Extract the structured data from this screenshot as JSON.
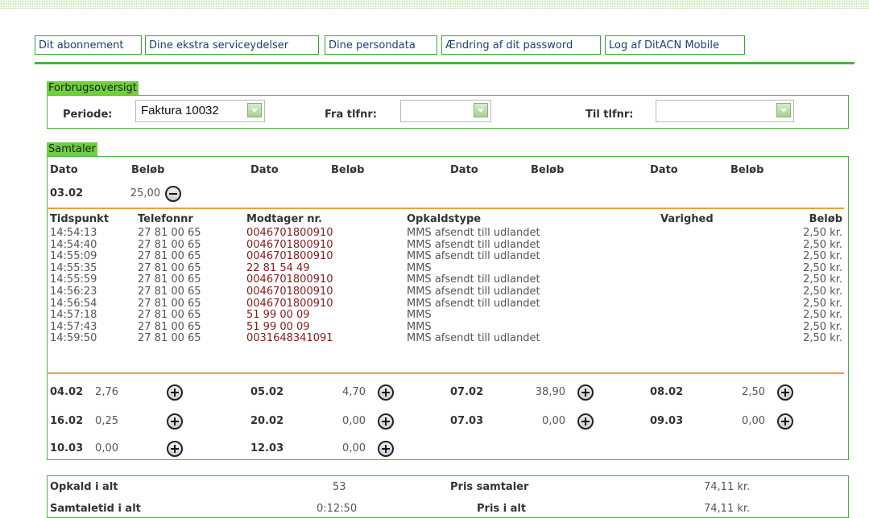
{
  "tabs": [
    "Dit abonnement",
    "Dine ekstra serviceydelser",
    "Dine persondata",
    "Ændring af dit password",
    "Log af DitACN Mobile"
  ],
  "usage": {
    "title": "Forbrugsoversigt",
    "periode_label": "Periode:",
    "periode_value": "Faktura 10032",
    "fra_label": "Fra tlfnr:",
    "fra_value": "",
    "til_label": "Til tlfnr:",
    "til_value": ""
  },
  "calls": {
    "title": "Samtaler",
    "col_headers": [
      "Dato",
      "Beløb",
      "Dato",
      "Beløb",
      "Dato",
      "Beløb",
      "Dato",
      "Beløb"
    ],
    "expanded_day": {
      "date": "03.02",
      "amount": "25,00"
    },
    "detail_headers": [
      "Tidspunkt",
      "Telefonnr",
      "Modtager nr.",
      "Opkaldstype",
      "Varighed",
      "Beløb"
    ],
    "detail_rows": [
      {
        "time": "14:54:13",
        "phone": "27 81 00 65",
        "receiver": "0046701800910",
        "type": "MMS afsendt till udlandet",
        "duration": "",
        "amount": "2,50 kr."
      },
      {
        "time": "14:54:40",
        "phone": "27 81 00 65",
        "receiver": "0046701800910",
        "type": "MMS afsendt till udlandet",
        "duration": "",
        "amount": "2,50 kr."
      },
      {
        "time": "14:55:09",
        "phone": "27 81 00 65",
        "receiver": "0046701800910",
        "type": "MMS afsendt till udlandet",
        "duration": "",
        "amount": "2,50 kr."
      },
      {
        "time": "14:55:35",
        "phone": "27 81 00 65",
        "receiver": "22 81 54 49",
        "type": "MMS",
        "duration": "",
        "amount": "2,50 kr."
      },
      {
        "time": "14:55:59",
        "phone": "27 81 00 65",
        "receiver": "0046701800910",
        "type": "MMS afsendt till udlandet",
        "duration": "",
        "amount": "2,50 kr."
      },
      {
        "time": "14:56:23",
        "phone": "27 81 00 65",
        "receiver": "0046701800910",
        "type": "MMS afsendt till udlandet",
        "duration": "",
        "amount": "2,50 kr."
      },
      {
        "time": "14:56:54",
        "phone": "27 81 00 65",
        "receiver": "0046701800910",
        "type": "MMS afsendt till udlandet",
        "duration": "",
        "amount": "2,50 kr."
      },
      {
        "time": "14:57:18",
        "phone": "27 81 00 65",
        "receiver": "51 99 00 09",
        "type": "MMS",
        "duration": "",
        "amount": "2,50 kr."
      },
      {
        "time": "14:57:43",
        "phone": "27 81 00 65",
        "receiver": "51 99 00 09",
        "type": "MMS",
        "duration": "",
        "amount": "2,50 kr."
      },
      {
        "time": "14:59:50",
        "phone": "27 81 00 65",
        "receiver": "0031648341091",
        "type": "MMS afsendt till udlandet",
        "duration": "",
        "amount": "2,50 kr."
      }
    ],
    "collapsed_days": [
      {
        "date": "04.02",
        "amount": "2,76"
      },
      {
        "date": "05.02",
        "amount": "4,70"
      },
      {
        "date": "07.02",
        "amount": "38,90"
      },
      {
        "date": "08.02",
        "amount": "2,50"
      },
      {
        "date": "16.02",
        "amount": "0,25"
      },
      {
        "date": "20.02",
        "amount": "0,00"
      },
      {
        "date": "07.03",
        "amount": "0,00"
      },
      {
        "date": "09.03",
        "amount": "0,00"
      },
      {
        "date": "10.03",
        "amount": "0,00"
      },
      {
        "date": "12.03",
        "amount": "0,00"
      }
    ]
  },
  "summary": {
    "opkald_label": "Opkald i alt",
    "opkald_value": "53",
    "samtaletid_label": "Samtaletid i alt",
    "samtaletid_value": "0:12:50",
    "pris_samtaler_label": "Pris samtaler",
    "pris_samtaler_value": "74,11 kr.",
    "pris_alt_label": "Pris i alt",
    "pris_alt_value": "74,11 kr."
  },
  "colors": {
    "green": "#4cb244",
    "orange": "#e8a23a",
    "link": "#1a3f7a",
    "receiver": "#8a1a1a"
  }
}
